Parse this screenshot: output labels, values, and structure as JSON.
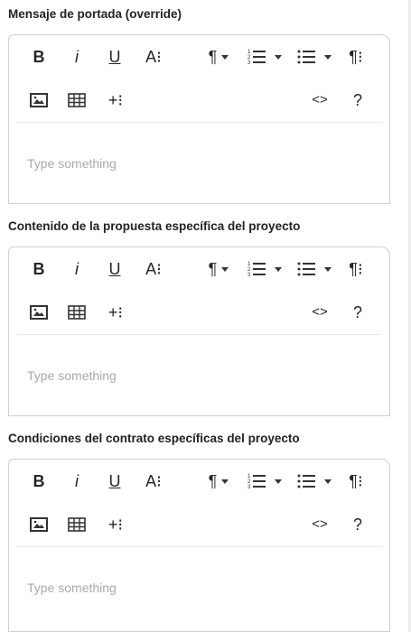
{
  "fields": [
    {
      "label": "Mensaje de portada (override)",
      "placeholder": "Type something"
    },
    {
      "label": "Contenido de la propuesta específica del proyecto",
      "placeholder": "Type something"
    },
    {
      "label": "Condiciones del contrato específicas del proyecto",
      "placeholder": "Type something"
    }
  ],
  "toolbar": {
    "bold": "B",
    "italic": "i",
    "underline": "U",
    "font_size": "A⁝",
    "paragraph": "¶",
    "paragraph_style": "¶⁝",
    "insert_more": "+⁝",
    "code_view": "<>",
    "help": "?"
  },
  "icons": [
    "bold-icon",
    "italic-icon",
    "underline-icon",
    "font-size-icon",
    "paragraph-format-icon",
    "ordered-list-icon",
    "unordered-list-icon",
    "paragraph-style-icon",
    "image-icon",
    "table-icon",
    "insert-more-icon",
    "code-view-icon",
    "help-icon"
  ]
}
